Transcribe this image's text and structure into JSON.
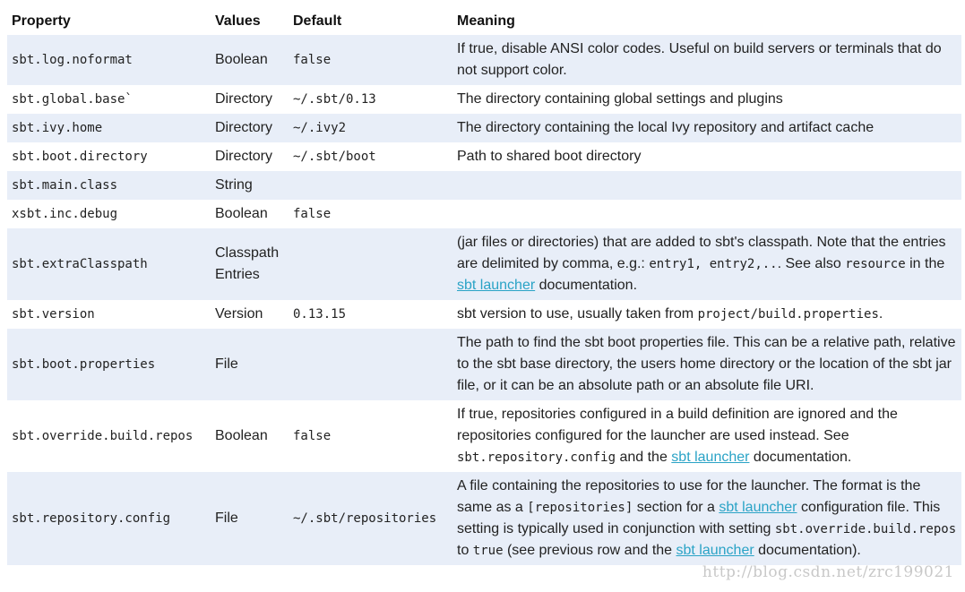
{
  "table": {
    "headers": {
      "property": "Property",
      "values": "Values",
      "default": "Default",
      "meaning": "Meaning"
    },
    "rows": [
      {
        "property": "sbt.log.noformat",
        "values": "Boolean",
        "default": "false",
        "meaning": [
          {
            "t": "If true, disable ANSI color codes. Useful on build servers or terminals that do not support color."
          }
        ]
      },
      {
        "property": "sbt.global.base`",
        "values": "Directory",
        "default": "~/.sbt/0.13",
        "meaning": [
          {
            "t": "The directory containing global settings and plugins"
          }
        ]
      },
      {
        "property": "sbt.ivy.home",
        "values": "Directory",
        "default": "~/.ivy2",
        "meaning": [
          {
            "t": "The directory containing the local Ivy repository and artifact cache"
          }
        ]
      },
      {
        "property": "sbt.boot.directory",
        "values": "Directory",
        "default": "~/.sbt/boot",
        "meaning": [
          {
            "t": "Path to shared boot directory"
          }
        ]
      },
      {
        "property": "sbt.main.class",
        "values": "String",
        "default": "",
        "meaning": []
      },
      {
        "property": "xsbt.inc.debug",
        "values": "Boolean",
        "default": "false",
        "meaning": []
      },
      {
        "property": "sbt.extraClasspath",
        "values": "Classpath Entries",
        "default": "",
        "meaning": [
          {
            "t": "(jar files or directories) that are added to sbt's classpath. Note that the entries are delimited by comma, e.g.: "
          },
          {
            "t": "entry1, entry2,..",
            "code": true
          },
          {
            "t": ". See also "
          },
          {
            "t": "resource",
            "code": true
          },
          {
            "t": " in the "
          },
          {
            "t": "sbt launcher",
            "link": true
          },
          {
            "t": " documentation."
          }
        ]
      },
      {
        "property": "sbt.version",
        "values": "Version",
        "default": "0.13.15",
        "meaning": [
          {
            "t": "sbt version to use, usually taken from "
          },
          {
            "t": "project/build.properties",
            "code": true
          },
          {
            "t": "."
          }
        ]
      },
      {
        "property": "sbt.boot.properties",
        "values": "File",
        "default": "",
        "meaning": [
          {
            "t": "The path to find the sbt boot properties file. This can be a relative path, relative to the sbt base directory, the users home directory or the location of the sbt jar file, or it can be an absolute path or an absolute file URI."
          }
        ]
      },
      {
        "property": "sbt.override.build.repos",
        "values": "Boolean",
        "default": "false",
        "meaning": [
          {
            "t": "If true, repositories configured in a build definition are ignored and the repositories configured for the launcher are used instead. See "
          },
          {
            "t": "sbt.repository.config",
            "code": true
          },
          {
            "t": " and the "
          },
          {
            "t": "sbt launcher",
            "link": true
          },
          {
            "t": " documentation."
          }
        ]
      },
      {
        "property": "sbt.repository.config",
        "values": "File",
        "default": "~/.sbt/repositories",
        "meaning": [
          {
            "t": "A file containing the repositories to use for the launcher. The format is the same as a "
          },
          {
            "t": "[repositories]",
            "code": true
          },
          {
            "t": " section for a "
          },
          {
            "t": "sbt launcher",
            "link": true
          },
          {
            "t": " configuration file. This setting is typically used in conjunction with setting "
          },
          {
            "t": "sbt.override.build.repos",
            "code": true
          },
          {
            "t": " to "
          },
          {
            "t": "true",
            "code": true
          },
          {
            "t": " (see previous row and the "
          },
          {
            "t": "sbt launcher",
            "link": true
          },
          {
            "t": " documentation)."
          }
        ]
      }
    ]
  },
  "watermark": "http://blog.csdn.net/zrc199021",
  "colors": {
    "stripe": "#e8eef8",
    "link": "#2aa3c6"
  }
}
